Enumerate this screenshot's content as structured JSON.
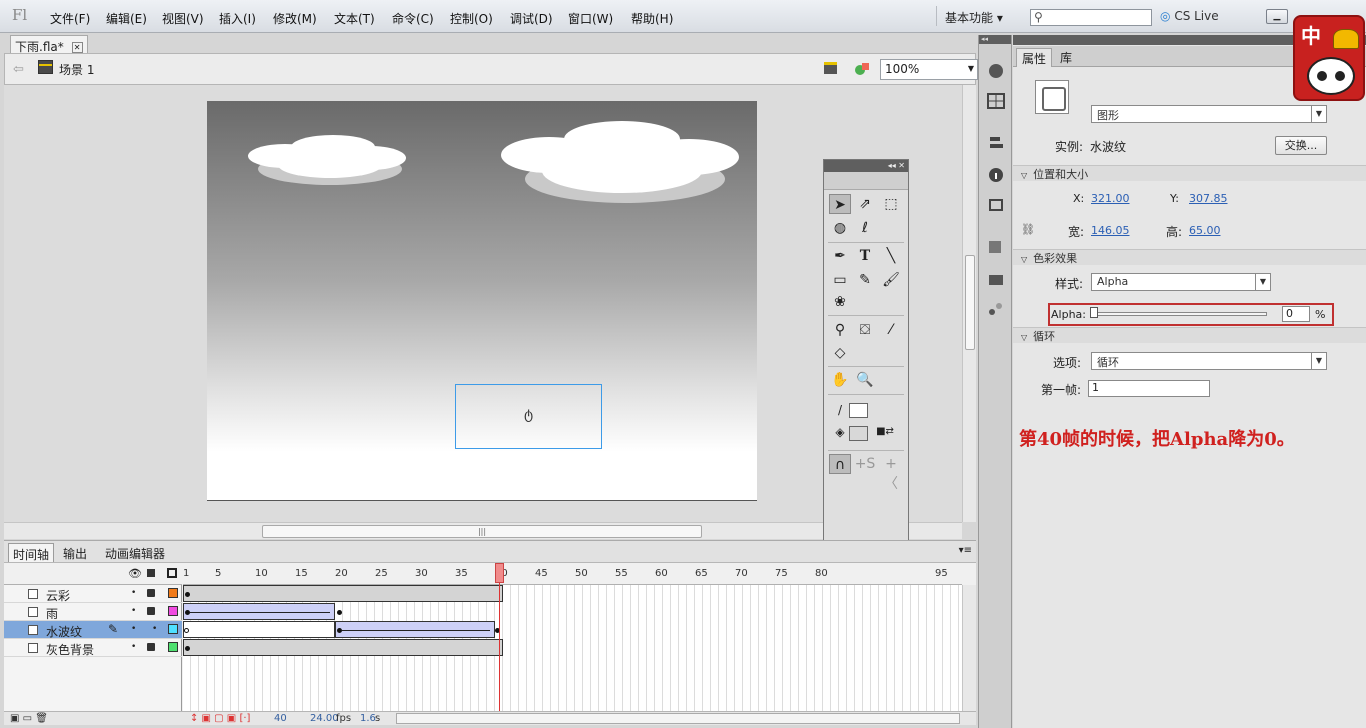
{
  "app": {
    "logo": "Fl"
  },
  "menu": [
    "文件(F)",
    "编辑(E)",
    "视图(V)",
    "插入(I)",
    "修改(M)",
    "文本(T)",
    "命令(C)",
    "控制(O)",
    "调试(D)",
    "窗口(W)",
    "帮助(H)"
  ],
  "workspace": {
    "label": "基本功能 ▾"
  },
  "search": {
    "icon": "search-icon",
    "value": ""
  },
  "cslive": {
    "label": "CS Live"
  },
  "window_buttons": [
    "minimize",
    "restore",
    "close"
  ],
  "document": {
    "tab": "下雨.fla*"
  },
  "scene": {
    "label": "场景 1",
    "zoom": "100%"
  },
  "tools_panel": {
    "tools": [
      "selection-tool",
      "subselection-tool",
      "free-transform-tool",
      "3d-rotation-tool",
      "lasso-tool",
      "pen-tool",
      "text-tool",
      "line-tool",
      "rectangle-tool",
      "pencil-tool",
      "brush-tool",
      "deco-tool",
      "bone-tool",
      "paint-bucket-tool",
      "eyedropper-tool",
      "eraser-tool",
      "hand-tool",
      "zoom-tool",
      "stroke-color",
      "fill-color",
      "snap-to-objects",
      "smooth",
      "straighten"
    ],
    "text_tool_glyph": "T"
  },
  "timeline": {
    "tabs": [
      "时间轴",
      "输出",
      "动画编辑器"
    ],
    "frame_numbers": [
      "1",
      "5",
      "10",
      "15",
      "20",
      "25",
      "30",
      "35",
      "40",
      "45",
      "50",
      "55",
      "60",
      "65",
      "70",
      "75",
      "80",
      "95"
    ],
    "layers": [
      {
        "name": "云彩",
        "color": "#f07a1a",
        "selected": false
      },
      {
        "name": "雨",
        "color": "#f04be0",
        "selected": false
      },
      {
        "name": "水波纹",
        "color": "#4fe0ff",
        "selected": true
      },
      {
        "name": "灰色背景",
        "color": "#4fe070",
        "selected": false
      }
    ],
    "current_frame": "40",
    "fps": "24.00",
    "fps_unit": "fps",
    "elapsed": "1.6",
    "elapsed_unit": "s"
  },
  "properties": {
    "tabs": [
      "属性",
      "库"
    ],
    "symbol_type": "图形",
    "instance_label": "实例:",
    "instance_name": "水波纹",
    "swap_button": "交换...",
    "position_size_section": "位置和大小",
    "x_label": "X:",
    "x": "321.00",
    "y_label": "Y:",
    "y": "307.85",
    "width_label": "宽:",
    "width": "146.05",
    "height_label": "高:",
    "height": "65.00",
    "color_effect_section": "色彩效果",
    "style_label": "样式:",
    "style": "Alpha",
    "alpha_label": "Alpha:",
    "alpha_value": "0",
    "alpha_unit": "%",
    "alpha_level": 0,
    "loop_section": "循环",
    "options_label": "选项:",
    "option": "循环",
    "first_frame_label": "第一帧:",
    "first_frame": "1"
  },
  "annotation": "第40帧的时候，把Alpha降为0。",
  "mascot": {
    "char": "中"
  }
}
